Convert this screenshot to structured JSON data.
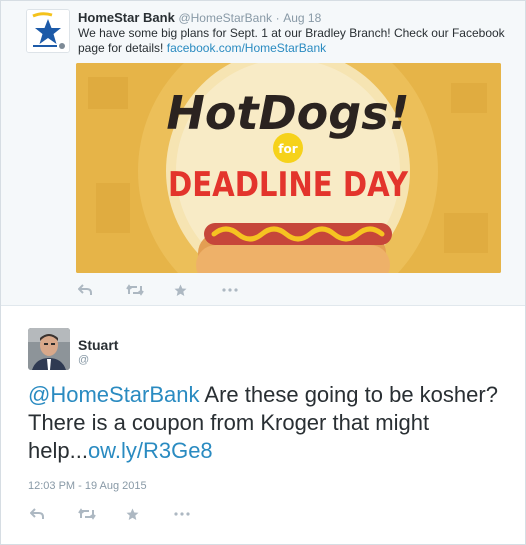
{
  "tweet1": {
    "name": "HomeStar Bank",
    "handle": "@HomeStarBank",
    "separator": "·",
    "time": "Aug 18",
    "text": "We have some big plans for Sept. 1 at our Bradley Branch! Check our Facebook page for details! ",
    "link": "facebook.com/HomeStarBank",
    "image": {
      "title": "HotDogs!",
      "for": "for",
      "subtitle": "DEADLINE DAY",
      "colors": {
        "background": "#e8b84d",
        "title": "#2b2320",
        "subtitle": "#e3342c",
        "badge": "#f6d21b"
      }
    },
    "actions": [
      "reply-icon",
      "retweet-icon",
      "favorite-icon",
      "more-icon"
    ]
  },
  "tweet2": {
    "name": "Stuart",
    "handle": "@",
    "mention": "@HomeStarBank",
    "text": " Are these going to be kosher? There is a coupon from Kroger that might help...",
    "link": "ow.ly/R3Ge8",
    "timestamp": "12:03 PM - 19 Aug 2015",
    "actions": [
      "reply-icon",
      "retweet-icon",
      "favorite-icon",
      "more-icon"
    ]
  },
  "colors": {
    "link": "#2a8bc1",
    "muted": "#8899a6",
    "text": "#292f33",
    "topBackground": "#f5f8fa"
  }
}
